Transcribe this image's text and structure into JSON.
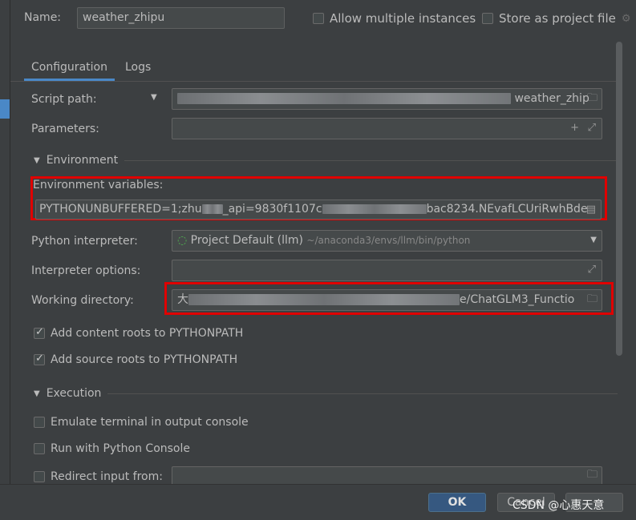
{
  "header": {
    "name_label": "Name:",
    "name_value": "weather_zhipu",
    "allow_multiple_label": "Allow multiple instances",
    "store_project_label": "Store as project file"
  },
  "tabs": [
    "Configuration",
    "Logs"
  ],
  "form": {
    "script_path_label": "Script path:",
    "script_path_value": "weather_zhip",
    "parameters_label": "Parameters:",
    "environment_section": "Environment",
    "env_vars_label": "Environment variables:",
    "env_vars_value_a": "PYTHONUNBUFFERED=1;zhu",
    "env_vars_value_b": "_api=9830f1107c",
    "env_vars_value_c": "bac8234.NEvafLCUriRwhBde",
    "interpreter_label": "Python interpreter:",
    "interpreter_value": "Project Default (llm)",
    "interpreter_path": "~/anaconda3/envs/llm/bin/python",
    "interp_options_label": "Interpreter options:",
    "working_dir_label": "Working directory:",
    "working_dir_prefix": "大",
    "working_dir_value": "e/ChatGLM3_Functio",
    "add_content_roots": "Add content roots to PYTHONPATH",
    "add_source_roots": "Add source roots to PYTHONPATH",
    "execution_section": "Execution",
    "emulate_terminal": "Emulate terminal in output console",
    "run_python_console": "Run with Python Console",
    "redirect_input": "Redirect input from:"
  },
  "footer": {
    "ok_label": "OK",
    "cancel_label": "Cancel",
    "watermark": "CSDN @心惠天意"
  },
  "colors": {
    "accent": "#4a88c7",
    "highlight": "#e00000",
    "background": "#3c3f41"
  }
}
